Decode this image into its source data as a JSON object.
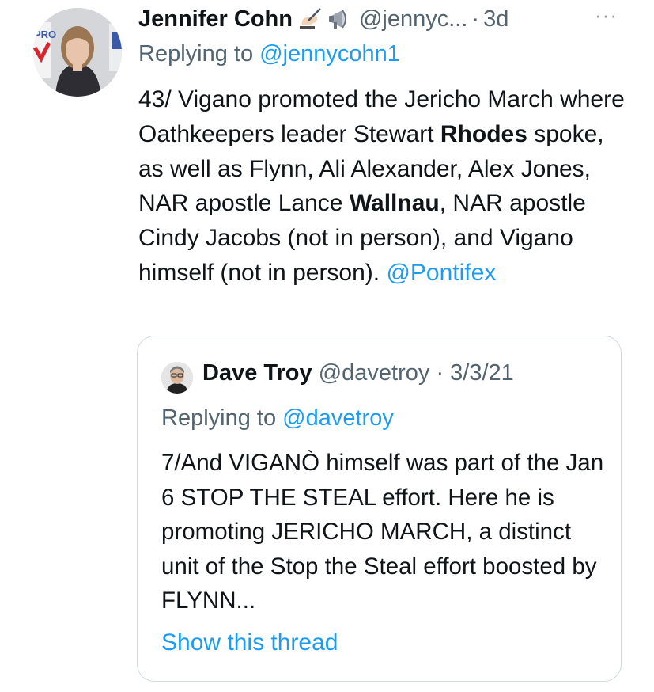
{
  "tweet": {
    "author_name": "Jennifer Cohn",
    "author_handle": "@jennyc...",
    "time": "3d",
    "more_label": "···",
    "reply_prefix": "Replying to",
    "reply_to": "@jennycohn1",
    "text_runs": [
      {
        "text": "43/ Vigano promoted the Jericho March where Oathkeepers leader Stewart ",
        "style": "normal"
      },
      {
        "text": "Rhodes",
        "style": "bold"
      },
      {
        "text": " spoke, as well as Flynn, Ali Alexander, Alex Jones, NAR apostle Lance ",
        "style": "normal"
      },
      {
        "text": "Wallnau",
        "style": "bold"
      },
      {
        "text": ", NAR apostle Cindy Jacobs (not in person), and Vigano himself (not in person). ",
        "style": "normal"
      },
      {
        "text": "@Pontifex",
        "style": "link"
      }
    ],
    "avatar_sign_text": "PRO"
  },
  "quote": {
    "author_name": "Dave Troy",
    "author_handle": "@davetroy",
    "date": "3/3/21",
    "separator": "·",
    "reply_prefix": "Replying to",
    "reply_to": "@davetroy",
    "text": "7/And VIGANÒ himself was part of the Jan 6 STOP THE STEAL effort. Here he is promoting JERICHO MARCH, a distinct unit of the Stop the Steal effort boosted by FLYNN...",
    "show_thread_label": "Show this thread"
  },
  "colors": {
    "link": "#1d9bf0",
    "secondary_text": "#536471",
    "border": "#cfd9de"
  },
  "icons": [
    "writing-hand-emoji-icon",
    "megaphone-emoji-icon",
    "more-options-icon"
  ]
}
